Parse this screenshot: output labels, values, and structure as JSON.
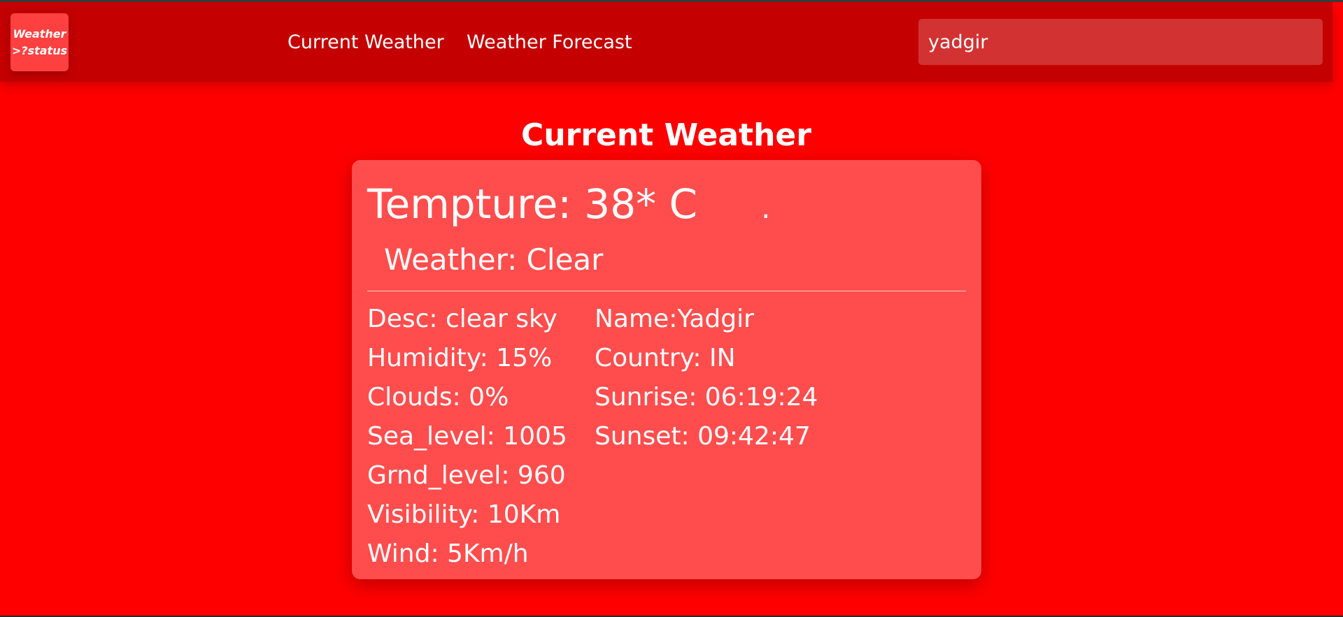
{
  "header": {
    "logo_line1": "Weather",
    "logo_line2": ">?status",
    "nav": {
      "current_weather": "Current Weather",
      "weather_forecast": "Weather Forecast"
    },
    "search": {
      "value": "yadgir",
      "placeholder": ""
    }
  },
  "main": {
    "title": "Current Weather",
    "card": {
      "temperature": "Tempture: 38* C",
      "weather": "Weather: Clear",
      "left_details": [
        "Desc: clear sky",
        "Humidity: 15%",
        "Clouds: 0%",
        "Sea_level: 1005",
        "Grnd_level: 960",
        "Visibility: 10Km",
        "Wind: 5Km/h"
      ],
      "right_details": [
        "Name:Yadgir",
        "Country: IN",
        "Sunrise: 06:19:24",
        "Sunset: 09:42:47"
      ]
    }
  },
  "colors": {
    "page_background": "#ff0000",
    "header_background": "#c40000",
    "logo_background": "#ff4040",
    "search_background": "#d23232",
    "card_background": "#ff4d4d",
    "text": "#ffffff"
  }
}
